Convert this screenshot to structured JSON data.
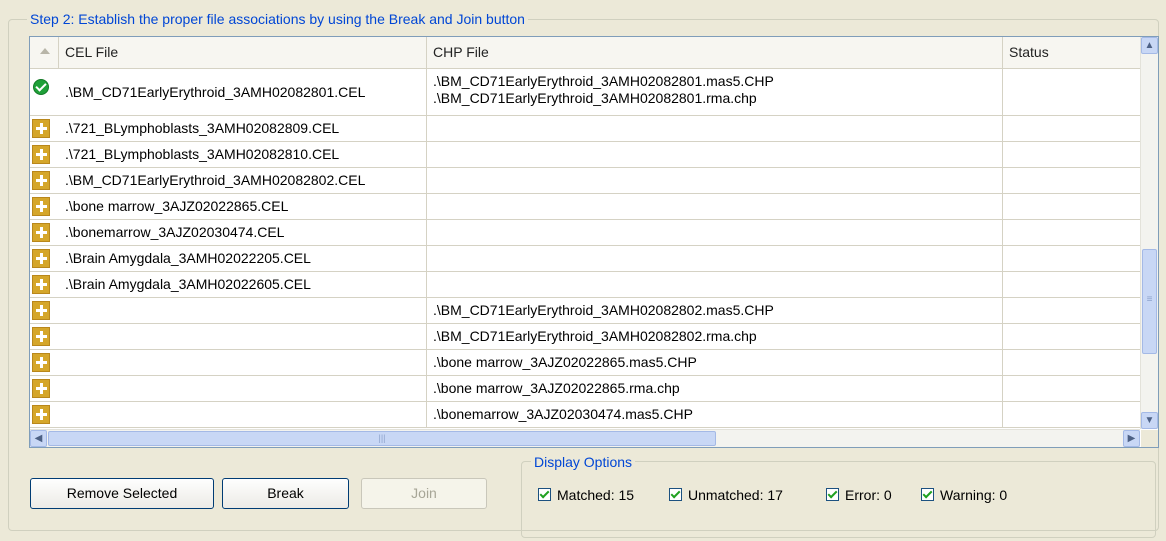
{
  "step_title": "Step 2: Establish the proper file associations by using the Break and Join button",
  "columns": {
    "cel": "CEL File",
    "chp": "CHP File",
    "status": "Status"
  },
  "rows": [
    {
      "icon": "matched",
      "cel": ".\\BM_CD71EarlyErythroid_3AMH02082801.CEL",
      "chp": [
        ".\\BM_CD71EarlyErythroid_3AMH02082801.mas5.CHP",
        ".\\BM_CD71EarlyErythroid_3AMH02082801.rma.chp"
      ],
      "status": ""
    },
    {
      "icon": "unmatched",
      "cel": ".\\721_BLymphoblasts_3AMH02082809.CEL",
      "chp": [],
      "status": ""
    },
    {
      "icon": "unmatched",
      "cel": ".\\721_BLymphoblasts_3AMH02082810.CEL",
      "chp": [],
      "status": ""
    },
    {
      "icon": "unmatched",
      "cel": ".\\BM_CD71EarlyErythroid_3AMH02082802.CEL",
      "chp": [],
      "status": ""
    },
    {
      "icon": "unmatched",
      "cel": ".\\bone marrow_3AJZ02022865.CEL",
      "chp": [],
      "status": ""
    },
    {
      "icon": "unmatched",
      "cel": ".\\bonemarrow_3AJZ02030474.CEL",
      "chp": [],
      "status": ""
    },
    {
      "icon": "unmatched",
      "cel": ".\\Brain Amygdala_3AMH02022205.CEL",
      "chp": [],
      "status": ""
    },
    {
      "icon": "unmatched",
      "cel": ".\\Brain Amygdala_3AMH02022605.CEL",
      "chp": [],
      "status": ""
    },
    {
      "icon": "unmatched",
      "cel": "",
      "chp": [
        ".\\BM_CD71EarlyErythroid_3AMH02082802.mas5.CHP"
      ],
      "status": ""
    },
    {
      "icon": "unmatched",
      "cel": "",
      "chp": [
        ".\\BM_CD71EarlyErythroid_3AMH02082802.rma.chp"
      ],
      "status": ""
    },
    {
      "icon": "unmatched",
      "cel": "",
      "chp": [
        ".\\bone marrow_3AJZ02022865.mas5.CHP"
      ],
      "status": ""
    },
    {
      "icon": "unmatched",
      "cel": "",
      "chp": [
        ".\\bone marrow_3AJZ02022865.rma.chp"
      ],
      "status": ""
    },
    {
      "icon": "unmatched",
      "cel": "",
      "chp": [
        ".\\bonemarrow_3AJZ02030474.mas5.CHP"
      ],
      "status": ""
    }
  ],
  "buttons": {
    "remove": "Remove Selected",
    "break": "Break",
    "join": "Join"
  },
  "display_options": {
    "title": "Display Options",
    "items": [
      {
        "label": "Matched: 15",
        "checked": true
      },
      {
        "label": "Unmatched: 17",
        "checked": true
      },
      {
        "label": "Error: 0",
        "checked": true
      },
      {
        "label": "Warning: 0",
        "checked": true
      }
    ]
  },
  "scrollbar_glyphs": {
    "up": "▲",
    "down": "▼",
    "left": "◀",
    "right": "▶",
    "grip": "≡",
    "hgrip": "|||"
  }
}
